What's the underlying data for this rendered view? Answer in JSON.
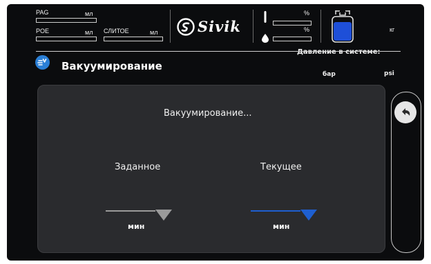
{
  "header": {
    "oil_meters": [
      {
        "name": "PAG",
        "unit": "мл"
      },
      {
        "name": "POE",
        "unit": "мл"
      },
      {
        "name": "СЛИТОЕ",
        "unit": "мл"
      }
    ],
    "brand": "Sivik",
    "gauges": [
      {
        "icon": "thermometer-icon",
        "unit": "%"
      },
      {
        "icon": "drop-icon",
        "unit": "%"
      }
    ],
    "tank": {
      "icon": "refrigerant-tank-icon",
      "unit": "кг",
      "color": "#1e4fd8"
    }
  },
  "title_bar": {
    "icon": "vacuum-icon",
    "title": "Вакуумирование",
    "pressure_title": "Давление в системе:",
    "pressure_units": [
      "бар",
      "psi"
    ]
  },
  "panel": {
    "status": "Вакуумирование...",
    "setpoint": {
      "label": "Заданное",
      "unit": "мин",
      "line_color": "#9a9a9a"
    },
    "current": {
      "label": "Текущее",
      "unit": "мин",
      "line_color": "#1e5fd0"
    }
  },
  "side": {
    "back_icon": "back-arrow-icon"
  },
  "colors": {
    "accent": "#1e5fd0",
    "panel": "#2a2b2e",
    "background": "#0b0c0e"
  }
}
